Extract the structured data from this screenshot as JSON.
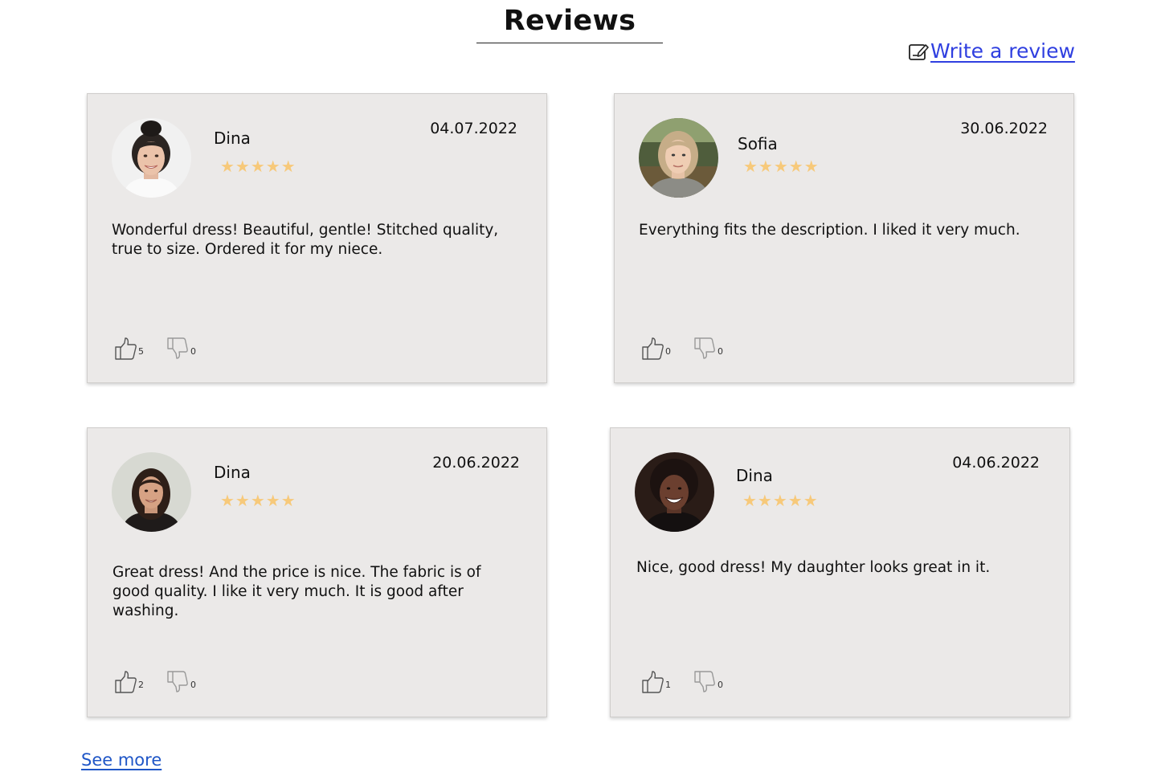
{
  "header": {
    "title": "Reviews",
    "write_review_label": "Write a review"
  },
  "reviews": [
    {
      "name": "Dina",
      "date": "04.07.2022",
      "rating": 5,
      "stars": "★★★★★",
      "text": "Wonderful dress! Beautiful, gentle! Stitched quality, true to size. Ordered it for my niece.",
      "likes": "5",
      "dislikes": "0"
    },
    {
      "name": "Sofia",
      "date": "30.06.2022",
      "rating": 5,
      "stars": "★★★★★",
      "text": "Everything fits the description. I liked it very much.",
      "likes": "0",
      "dislikes": "0"
    },
    {
      "name": "Dina",
      "date": "20.06.2022",
      "rating": 5,
      "stars": "★★★★★",
      "text": "Great dress! And the price is nice. The fabric is of good quality. I like it very much. It is good after washing.",
      "likes": "2",
      "dislikes": "0"
    },
    {
      "name": "Dina",
      "date": "04.06.2022",
      "rating": 5,
      "stars": "★★★★★",
      "text": "Nice, good dress! My daughter looks great in it.",
      "likes": "1",
      "dislikes": "0"
    }
  ],
  "footer": {
    "see_more_label": "See more"
  },
  "colors": {
    "card_background": "#ebe9e8",
    "star": "#f7c97a",
    "link": "#2f3fe0",
    "see_more_link": "#1f56c7"
  },
  "icons": {
    "write_review": "edit-note-icon",
    "like": "thumbs-up-icon",
    "dislike": "thumbs-down-icon"
  }
}
